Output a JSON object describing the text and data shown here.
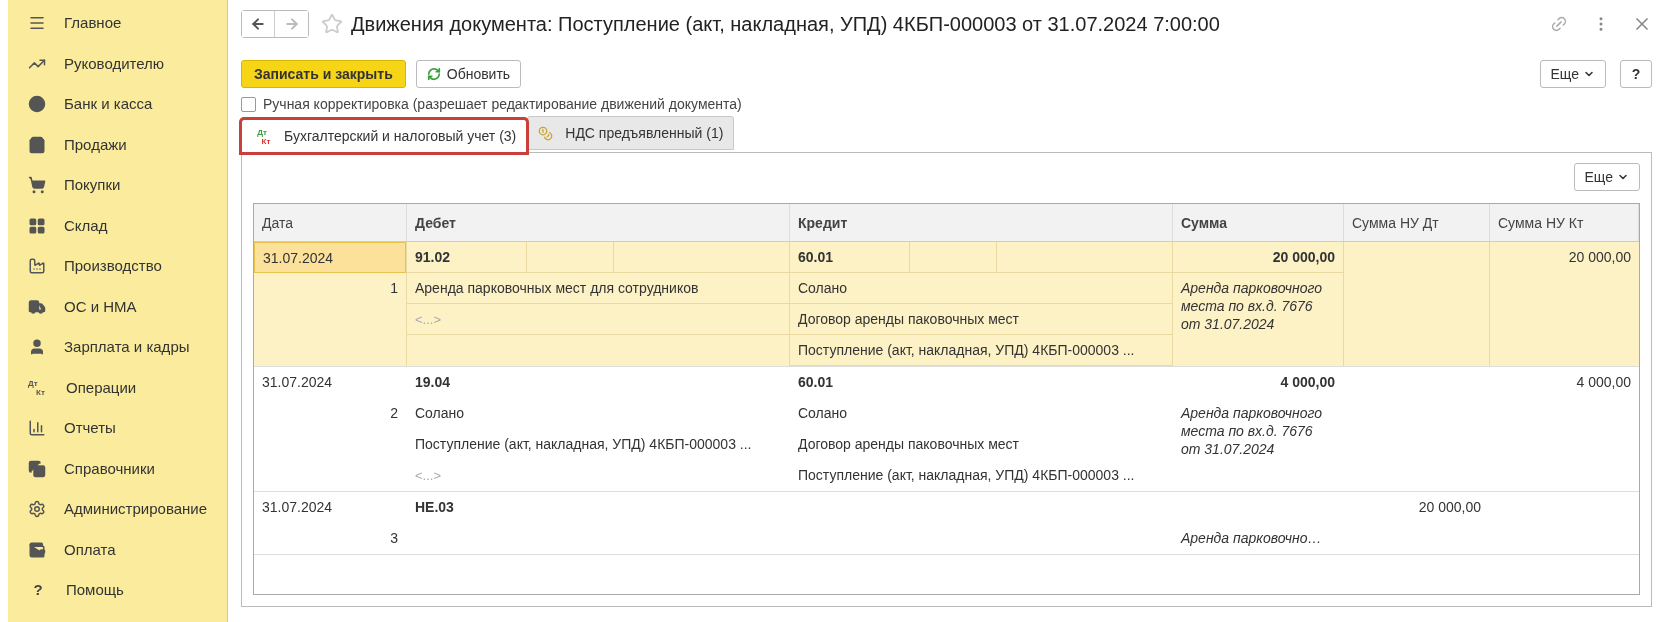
{
  "sidebar": {
    "items": [
      {
        "label": "Главное"
      },
      {
        "label": "Руководителю"
      },
      {
        "label": "Банк и касса"
      },
      {
        "label": "Продажи"
      },
      {
        "label": "Покупки"
      },
      {
        "label": "Склад"
      },
      {
        "label": "Производство"
      },
      {
        "label": "ОС и НМА"
      },
      {
        "label": "Зарплата и кадры"
      },
      {
        "label": "Операции",
        "icon_text": [
          "Дт",
          "Кт"
        ]
      },
      {
        "label": "Отчеты"
      },
      {
        "label": "Справочники"
      },
      {
        "label": "Администрирование"
      },
      {
        "label": "Оплата"
      },
      {
        "label": "Помощь",
        "icon_text": [
          "?"
        ]
      }
    ]
  },
  "window": {
    "title": "Движения документа: Поступление (акт, накладная, УПД) 4КБП-000003 от 31.07.2024 7:00:00"
  },
  "toolbar": {
    "save_button": "Записать и закрыть",
    "refresh_button": "Обновить",
    "more_button": "Еще",
    "help_button": "?"
  },
  "manual_edit": {
    "label": "Ручная корректировка (разрешает редактирование движений документа)",
    "checked": false
  },
  "tabs": [
    {
      "label": "Бухгалтерский и налоговый учет (3)",
      "selected": true,
      "highlighted": true,
      "icon_text": [
        "Дт",
        "Кт"
      ]
    },
    {
      "label": "НДС предъявленный (1)",
      "selected": false,
      "highlighted": false
    }
  ],
  "table": {
    "more_button": "Еще",
    "columns": [
      "Дата",
      "Дебет",
      "Кредит",
      "Сумма",
      "Сумма НУ Дт",
      "Сумма НУ Кт"
    ],
    "rows": [
      {
        "date": "31.07.2024",
        "number": "1",
        "selected": true,
        "debit": {
          "account": "91.02",
          "lines": [
            {
              "kind": "value",
              "text": "Аренда парковочных мест для сотрудников"
            },
            {
              "kind": "empty",
              "text": "<...>"
            }
          ]
        },
        "credit": {
          "account": "60.01",
          "lines": [
            {
              "kind": "value",
              "text": "Солано"
            },
            {
              "kind": "value",
              "text": "Договор аренды паковочных мест"
            },
            {
              "kind": "value",
              "text": "Поступление (акт, накладная, УПД) 4КБП-000003 ..."
            }
          ]
        },
        "sum": "20 000,00",
        "note": "Аренда парковочного места по вх.д. 7676 от 31.07.2024",
        "nu_kt": "20 000,00"
      },
      {
        "date": "31.07.2024",
        "number": "2",
        "selected": false,
        "debit": {
          "account": "19.04",
          "lines": [
            {
              "kind": "value",
              "text": "Солано"
            },
            {
              "kind": "value",
              "text": "Поступление (акт, накладная, УПД) 4КБП-000003 ..."
            },
            {
              "kind": "empty",
              "text": "<...>"
            }
          ]
        },
        "credit": {
          "account": "60.01",
          "lines": [
            {
              "kind": "value",
              "text": "Солано"
            },
            {
              "kind": "value",
              "text": "Договор аренды паковочных мест"
            },
            {
              "kind": "value",
              "text": "Поступление (акт, накладная, УПД) 4КБП-000003 ..."
            }
          ]
        },
        "sum": "4 000,00",
        "note": "Аренда парковочного места по вх.д. 7676 от 31.07.2024",
        "nu_kt": "4 000,00"
      },
      {
        "date": "31.07.2024",
        "number": "3",
        "selected": false,
        "debit": {
          "account": "НЕ.03"
        },
        "note": "Аренда парковочно…",
        "nu_dt": "20 000,00"
      }
    ]
  }
}
